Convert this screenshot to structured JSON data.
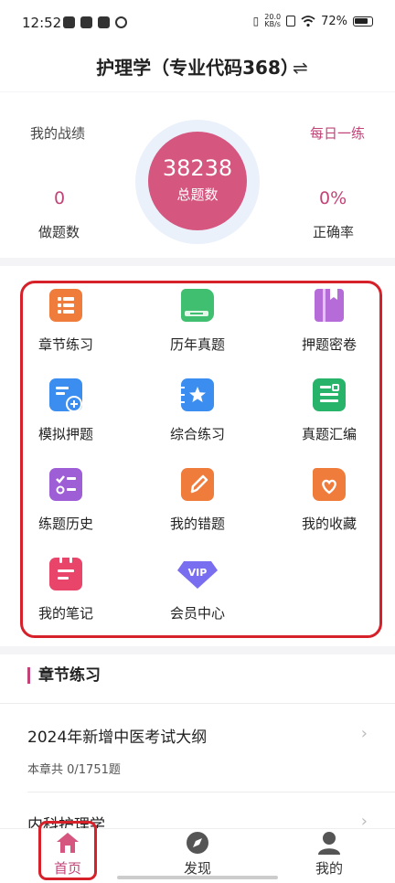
{
  "status": {
    "time": "12:52",
    "speed_top": "20.0",
    "speed_bottom": "KB/s",
    "battery": "72%"
  },
  "header": {
    "title": "护理学（专业代码368）",
    "swap_icon": "⇌"
  },
  "stats": {
    "left_label": "我的战绩",
    "right_label": "每日一练",
    "done_count": "0",
    "done_label": "做题数",
    "total_count": "38238",
    "total_label": "总题数",
    "accuracy": "0%",
    "accuracy_label": "正确率"
  },
  "grid": {
    "items": [
      {
        "label": "章节练习",
        "icon": "list-icon",
        "color": "#f07c3c"
      },
      {
        "label": "历年真题",
        "icon": "book-icon",
        "color": "#3fbf6f"
      },
      {
        "label": "押题密卷",
        "icon": "bookmark-book-icon",
        "color": "#b56cd9"
      },
      {
        "label": "模拟押题",
        "icon": "doc-plus-icon",
        "color": "#3b8df0"
      },
      {
        "label": "综合练习",
        "icon": "star-notebook-icon",
        "color": "#3b8df0"
      },
      {
        "label": "真题汇编",
        "icon": "doc-lines-icon",
        "color": "#27b46a"
      },
      {
        "label": "练题历史",
        "icon": "checklist-icon",
        "color": "#9e5fd6"
      },
      {
        "label": "我的错题",
        "icon": "edit-icon",
        "color": "#f07c3c"
      },
      {
        "label": "我的收藏",
        "icon": "heart-folder-icon",
        "color": "#f07c3c"
      },
      {
        "label": "我的笔记",
        "icon": "notebook-icon",
        "color": "#e9456a"
      },
      {
        "label": "会员中心",
        "icon": "vip-gem-icon",
        "color": "#7a6ef0"
      }
    ]
  },
  "section": {
    "title": "章节练习",
    "items": [
      {
        "name": "2024年新增中医考试大纲",
        "meta": "本章共  0/1751题"
      },
      {
        "name": "内科护理学",
        "meta": ""
      }
    ]
  },
  "tabbar": {
    "tabs": [
      {
        "label": "首页",
        "icon": "home-icon",
        "active": true
      },
      {
        "label": "发现",
        "icon": "compass-icon",
        "active": false
      },
      {
        "label": "我的",
        "icon": "user-icon",
        "active": false
      }
    ]
  },
  "colors": {
    "accent": "#c24377",
    "circle": "#d5567f",
    "highlight": "#d6202a"
  }
}
